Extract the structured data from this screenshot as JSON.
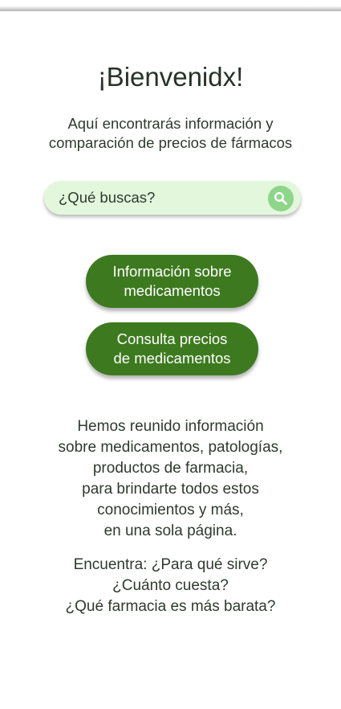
{
  "header": {
    "title": "¡Bienvenidx!",
    "subtitle_lines": [
      "Aquí encontrarás información y",
      "comparación de precios de fármacos"
    ]
  },
  "search": {
    "placeholder": "¿Qué buscas?",
    "icon": "search-icon"
  },
  "buttons": {
    "info_lines": [
      "Información sobre",
      "medicamentos"
    ],
    "prices_lines": [
      "Consulta precios",
      "de medicamentos"
    ]
  },
  "intro_lines": [
    "Hemos reunido información",
    "sobre medicamentos, patologías,",
    "productos de farmacia,",
    "para brindarte todos estos",
    "conocimientos y más,",
    "en una sola página."
  ],
  "questions_lines": [
    "Encuentra: ¿Para qué sirve?",
    "¿Cuánto cuesta?",
    "¿Qué farmacia es más barata?"
  ],
  "colors": {
    "primary_button": "#3d7a1f",
    "search_background": "#e3f7dd",
    "search_icon_background": "#8ed68a",
    "text": "#2e3a2e"
  }
}
